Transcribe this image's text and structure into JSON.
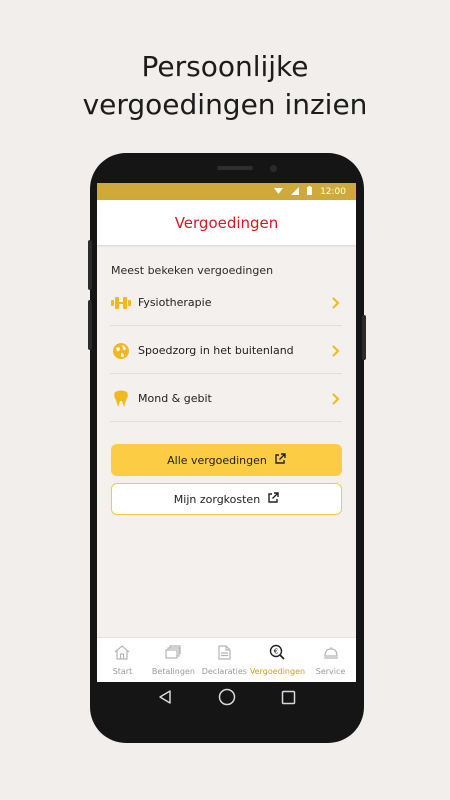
{
  "headline": {
    "line1": "Persoonlijke",
    "line2": "vergoedingen inzien"
  },
  "status_bar": {
    "time": "12:00"
  },
  "app_bar": {
    "title": "Vergoedingen"
  },
  "section": {
    "title": "Meest bekeken vergoedingen"
  },
  "list_items": [
    {
      "label": "Fysiotherapie",
      "icon": "dumbbell-icon"
    },
    {
      "label": "Spoedzorg in het buitenland",
      "icon": "globe-icon"
    },
    {
      "label": "Mond & gebit",
      "icon": "tooth-icon"
    }
  ],
  "buttons": {
    "primary_label": "Alle vergoedingen",
    "secondary_label": "Mijn zorgkosten"
  },
  "bottom_nav": [
    {
      "label": "Start",
      "icon": "home-icon"
    },
    {
      "label": "Betalingen",
      "icon": "payments-icon"
    },
    {
      "label": "Declaraties",
      "icon": "document-icon"
    },
    {
      "label": "Vergoedingen",
      "icon": "euro-search-icon",
      "active": true
    },
    {
      "label": "Service",
      "icon": "service-bell-icon"
    }
  ],
  "colors": {
    "accent": "#cfa93a",
    "primary_button": "#fccc45",
    "title_red": "#d31a23",
    "icon_yellow": "#f2b81f"
  }
}
